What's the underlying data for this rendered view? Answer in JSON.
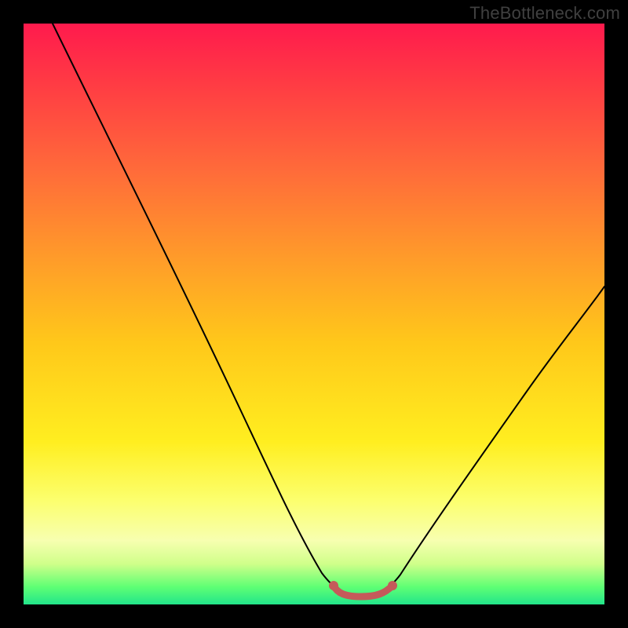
{
  "attribution": "TheBottleneck.com",
  "chart_data": {
    "type": "line",
    "title": "",
    "xlabel": "",
    "ylabel": "",
    "xlim": [
      0,
      100
    ],
    "ylim": [
      0,
      100
    ],
    "curve_points": [
      {
        "x": 5,
        "y": 100
      },
      {
        "x": 18,
        "y": 72
      },
      {
        "x": 30,
        "y": 45
      },
      {
        "x": 40,
        "y": 22
      },
      {
        "x": 48,
        "y": 7
      },
      {
        "x": 53,
        "y": 1
      },
      {
        "x": 58,
        "y": 0
      },
      {
        "x": 64,
        "y": 1
      },
      {
        "x": 70,
        "y": 7
      },
      {
        "x": 80,
        "y": 22
      },
      {
        "x": 90,
        "y": 38
      },
      {
        "x": 100,
        "y": 52
      }
    ],
    "highlighted_range": {
      "x_start": 53,
      "x_end": 64,
      "y": 0.5
    },
    "note": "V-shaped bottleneck curve over a rainbow heat gradient; the salmon segment marks the flat optimum region near the minimum."
  }
}
